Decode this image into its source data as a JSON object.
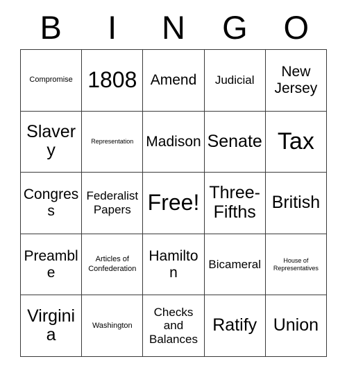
{
  "card": {
    "header_letters": [
      "B",
      "I",
      "N",
      "G",
      "O"
    ],
    "grid_rows": [
      [
        {
          "label": "Compromise",
          "size": "fs-xs"
        },
        {
          "label": "1808",
          "size": "fs-xxl"
        },
        {
          "label": "Amend",
          "size": "fs-lg"
        },
        {
          "label": "Judicial",
          "size": "fs-md"
        },
        {
          "label": "New Jersey",
          "size": "fs-lg"
        }
      ],
      [
        {
          "label": "Slavery",
          "size": "fs-xl"
        },
        {
          "label": "Representation",
          "size": "fs-xxs"
        },
        {
          "label": "Madison",
          "size": "fs-lg"
        },
        {
          "label": "Senate",
          "size": "fs-xl"
        },
        {
          "label": "Tax",
          "size": "fs-hug"
        }
      ],
      [
        {
          "label": "Congress",
          "size": "fs-lg"
        },
        {
          "label": "Federalist Papers",
          "size": "fs-md"
        },
        {
          "label": "Free!",
          "size": "fs-xxl"
        },
        {
          "label": "Three-Fifths",
          "size": "fs-xl"
        },
        {
          "label": "British",
          "size": "fs-xl"
        }
      ],
      [
        {
          "label": "Preamble",
          "size": "fs-lg"
        },
        {
          "label": "Articles of Confederation",
          "size": "fs-xs"
        },
        {
          "label": "Hamilton",
          "size": "fs-lg"
        },
        {
          "label": "Bicameral",
          "size": "fs-md"
        },
        {
          "label": "House of Representatives",
          "size": "fs-xxs"
        }
      ],
      [
        {
          "label": "Virginia",
          "size": "fs-xl"
        },
        {
          "label": "Washington",
          "size": "fs-xs"
        },
        {
          "label": "Checks and Balances",
          "size": "fs-md"
        },
        {
          "label": "Ratify",
          "size": "fs-xl"
        },
        {
          "label": "Union",
          "size": "fs-xl"
        }
      ]
    ],
    "colors": {
      "background": "#ffffff",
      "cell_background": "#ffffff",
      "border": "#3a3a3a",
      "text": "#000000"
    }
  }
}
